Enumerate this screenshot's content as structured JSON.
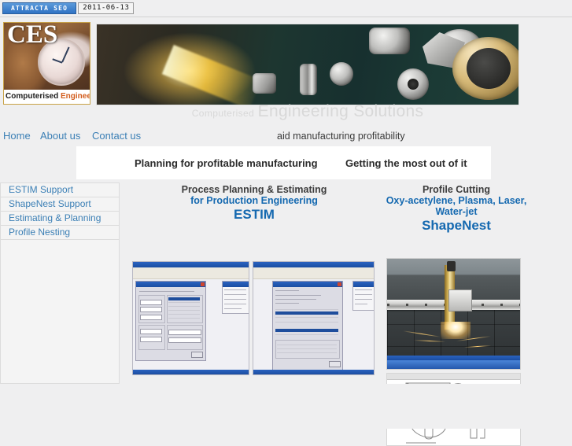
{
  "seo_bar": {
    "badge_label": "ATTRACTA SEO",
    "date": "2011-06-13"
  },
  "logo": {
    "letters": "CES",
    "caption_primary": "Computerised",
    "caption_accent": "Engineering",
    "alt": "ces-pocket-watch-logo"
  },
  "banner": {
    "alt": "machining-parts-banner",
    "tagline_small": "Computerised",
    "tagline_large": "Engineering Solutions"
  },
  "nav": {
    "items": [
      {
        "label": "Home",
        "name": "nav-item-home"
      },
      {
        "label": "About us",
        "name": "nav-item-about-us"
      },
      {
        "label": "Contact us",
        "name": "nav-item-contact-us"
      }
    ],
    "strapline": "aid manufacturing profitability"
  },
  "headline_box": {
    "left": "Planning for profitable manufacturing",
    "right": "Getting the most out of it"
  },
  "sidebar": {
    "items": [
      {
        "label": "ESTIM Support",
        "name": "sidebar-item-estim-support"
      },
      {
        "label": "ShapeNest Support",
        "name": "sidebar-item-shapenest-support"
      },
      {
        "label": "Estimating & Planning",
        "name": "sidebar-item-estimating-planning"
      },
      {
        "label": "Profile Nesting",
        "name": "sidebar-item-profile-nesting"
      }
    ]
  },
  "center_column": {
    "heading1": "Process Planning & Estimating",
    "heading2": "for Production Engineering",
    "product": "ESTIM",
    "screenshot1_alt": "estim-part-detail-window-screenshot",
    "screenshot2_alt": "estim-operation-summary-window-screenshot"
  },
  "right_column": {
    "heading1": "Profile Cutting",
    "heading2": "Oxy-acetylene, Plasma, Laser, Water-jet",
    "product": "ShapeNest",
    "photo_alt": "plasma-cutting-machine-photo",
    "drawing_alt": "shapenest-nesting-cad-drawing"
  },
  "colors": {
    "page_background": "#efeff0",
    "link_blue": "#3b7fb5",
    "heading_blue": "#1569b0",
    "heading_gray": "#3d3d3d",
    "badge_blue": "#3a7fcf",
    "logo_accent_orange": "#d25c1c",
    "tagline_gray": "#d8d8d8"
  }
}
